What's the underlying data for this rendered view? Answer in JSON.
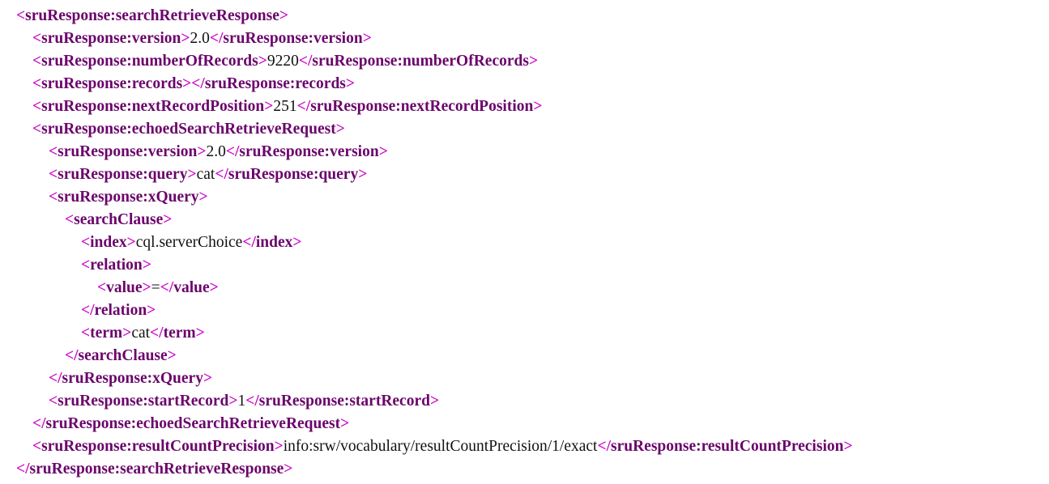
{
  "view": {
    "kind": "xml-tree-view",
    "document_title": "sruResponse:searchRetrieveResponse",
    "background_color": "#ffffff",
    "bracket_color": "#cc00cc",
    "tag_color": "#6b046b",
    "text_color": "#111111",
    "expander_collapse": "−",
    "expander_expand": "+"
  },
  "lines": [
    {
      "indent": 0,
      "expander": "−",
      "kind": "open",
      "tag": "sruResponse:searchRetrieveResponse"
    },
    {
      "indent": 1,
      "expander": "",
      "kind": "leaf",
      "tag": "sruResponse:version",
      "value": "2.0"
    },
    {
      "indent": 1,
      "expander": "",
      "kind": "leaf",
      "tag": "sruResponse:numberOfRecords",
      "value": "9220"
    },
    {
      "indent": 1,
      "expander": "+",
      "kind": "collapsed",
      "tag": "sruResponse:records",
      "value": ""
    },
    {
      "indent": 1,
      "expander": "",
      "kind": "leaf",
      "tag": "sruResponse:nextRecordPosition",
      "value": "251"
    },
    {
      "indent": 1,
      "expander": "−",
      "kind": "open",
      "tag": "sruResponse:echoedSearchRetrieveRequest"
    },
    {
      "indent": 2,
      "expander": "",
      "kind": "leaf",
      "tag": "sruResponse:version",
      "value": "2.0"
    },
    {
      "indent": 2,
      "expander": "",
      "kind": "leaf",
      "tag": "sruResponse:query",
      "value": "cat"
    },
    {
      "indent": 2,
      "expander": "−",
      "kind": "open",
      "tag": "sruResponse:xQuery"
    },
    {
      "indent": 3,
      "expander": "−",
      "kind": "open",
      "tag": "searchClause"
    },
    {
      "indent": 4,
      "expander": "",
      "kind": "leaf",
      "tag": "index",
      "value": "cql.serverChoice"
    },
    {
      "indent": 4,
      "expander": "−",
      "kind": "open",
      "tag": "relation"
    },
    {
      "indent": 5,
      "expander": "",
      "kind": "leaf",
      "tag": "value",
      "value": "="
    },
    {
      "indent": 4,
      "expander": "",
      "kind": "close",
      "tag": "relation"
    },
    {
      "indent": 4,
      "expander": "",
      "kind": "leaf",
      "tag": "term",
      "value": "cat"
    },
    {
      "indent": 3,
      "expander": "",
      "kind": "close",
      "tag": "searchClause"
    },
    {
      "indent": 2,
      "expander": "",
      "kind": "close",
      "tag": "sruResponse:xQuery"
    },
    {
      "indent": 2,
      "expander": "",
      "kind": "leaf",
      "tag": "sruResponse:startRecord",
      "value": "1"
    },
    {
      "indent": 1,
      "expander": "",
      "kind": "close",
      "tag": "sruResponse:echoedSearchRetrieveRequest"
    },
    {
      "indent": 1,
      "expander": "",
      "kind": "leaf",
      "tag": "sruResponse:resultCountPrecision",
      "value": "info:srw/vocabulary/resultCountPrecision/1/exact"
    },
    {
      "indent": 0,
      "expander": "",
      "kind": "close",
      "tag": "sruResponse:searchRetrieveResponse"
    }
  ]
}
